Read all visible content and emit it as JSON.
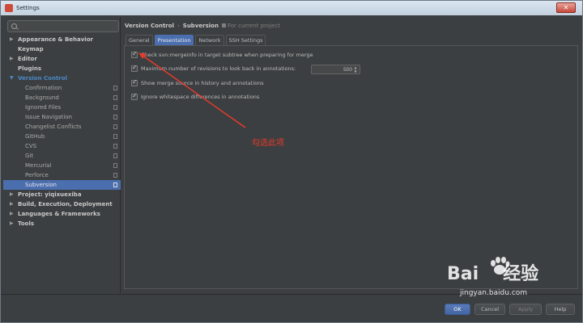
{
  "window": {
    "title": "Settings",
    "close_label": "✕"
  },
  "search": {
    "placeholder": "",
    "value": ""
  },
  "sidebar": {
    "items": [
      {
        "label": "Appearance & Behavior",
        "kind": "top",
        "arrow": "▶"
      },
      {
        "label": "Keymap",
        "kind": "top",
        "arrow": ""
      },
      {
        "label": "Editor",
        "kind": "top",
        "arrow": "▶"
      },
      {
        "label": "Plugins",
        "kind": "top",
        "arrow": ""
      },
      {
        "label": "Version Control",
        "kind": "expanded",
        "arrow": "▼"
      },
      {
        "label": "Confirmation",
        "kind": "child"
      },
      {
        "label": "Background",
        "kind": "child"
      },
      {
        "label": "Ignored Files",
        "kind": "child"
      },
      {
        "label": "Issue Navigation",
        "kind": "child"
      },
      {
        "label": "Changelist Conflicts",
        "kind": "child"
      },
      {
        "label": "GitHub",
        "kind": "child"
      },
      {
        "label": "CVS",
        "kind": "child"
      },
      {
        "label": "Git",
        "kind": "child"
      },
      {
        "label": "Mercurial",
        "kind": "child"
      },
      {
        "label": "Perforce",
        "kind": "child"
      },
      {
        "label": "Subversion",
        "kind": "child-selected"
      },
      {
        "label": "Project: yiqixuexiba",
        "kind": "top",
        "arrow": "▶"
      },
      {
        "label": "Build, Execution, Deployment",
        "kind": "top",
        "arrow": "▶"
      },
      {
        "label": "Languages & Frameworks",
        "kind": "top",
        "arrow": "▶"
      },
      {
        "label": "Tools",
        "kind": "top",
        "arrow": "▶"
      }
    ]
  },
  "breadcrumb": {
    "part1": "Version Control",
    "separator": "›",
    "part2": "Subversion",
    "note": "For current project"
  },
  "tabs": [
    {
      "label": "General",
      "active": false
    },
    {
      "label": "Presentation",
      "active": true
    },
    {
      "label": "Network",
      "active": false
    },
    {
      "label": "SSH Settings",
      "active": false
    }
  ],
  "options": {
    "check_mergeinfo": {
      "label": "Check svn:mergeinfo in target subtree when preparing for merge",
      "checked": true
    },
    "max_revisions": {
      "label": "Maximum number of revisions to look back in annotations:",
      "checked": true,
      "value": "500"
    },
    "show_merge_source": {
      "label": "Show merge source in history and annotations",
      "checked": true
    },
    "ignore_whitespace": {
      "label": "Ignore whitespace differences in annotations",
      "checked": true
    }
  },
  "annotation": {
    "text": "勾选此项",
    "color": "#e83a2c"
  },
  "footer": {
    "ok": "OK",
    "cancel": "Cancel",
    "apply": "Apply",
    "help": "Help"
  },
  "watermark": {
    "logo": "Bai",
    "logo_tail": "经验",
    "url": "jingyan.baidu.com"
  },
  "colors": {
    "accent": "#4b6eaf",
    "background": "#3c3f41",
    "annotation": "#e83a2c"
  }
}
